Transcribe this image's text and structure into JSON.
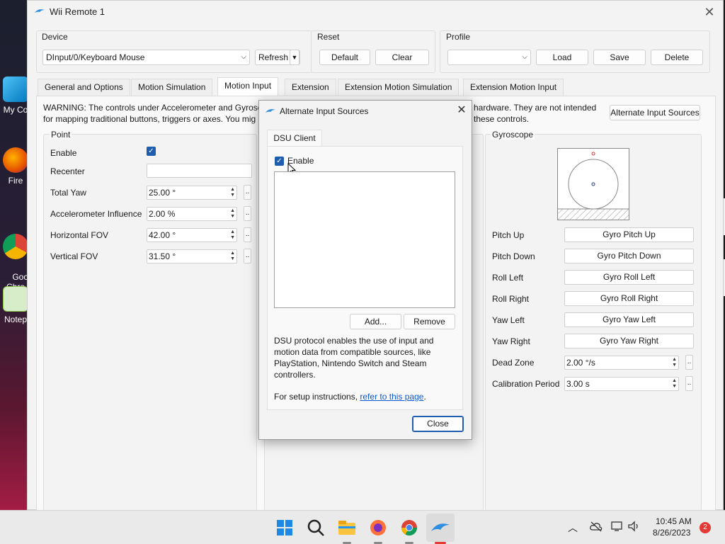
{
  "desktop": {
    "icons": [
      {
        "label": "My Co"
      },
      {
        "label": "Fire"
      },
      {
        "label": "Goo\nChro"
      },
      {
        "label": "Notep"
      }
    ]
  },
  "window": {
    "title": "Wii Remote 1",
    "device": {
      "group_label": "Device",
      "selected": "DInput/0/Keyboard Mouse",
      "refresh_label": "Refresh"
    },
    "reset": {
      "group_label": "Reset",
      "default_label": "Default",
      "clear_label": "Clear"
    },
    "profile": {
      "group_label": "Profile",
      "selected": "",
      "load_label": "Load",
      "save_label": "Save",
      "delete_label": "Delete"
    },
    "tabs": [
      {
        "label": "General and Options"
      },
      {
        "label": "Motion Simulation"
      },
      {
        "label": "Motion Input"
      },
      {
        "label": "Extension"
      },
      {
        "label": "Extension Motion Simulation"
      },
      {
        "label": "Extension Motion Input"
      }
    ],
    "warning_line1_left": "WARNING: The controls under Accelerometer and Gyrosc",
    "warning_line2_left": "for mapping traditional buttons, triggers or axes. You mig",
    "warning_line1_right": "hardware. They are not intended",
    "warning_line2_right": "these controls.",
    "alternate_sources_label": "Alternate Input Sources",
    "point": {
      "group_label": "Point",
      "enable_label": "Enable",
      "recenter_label": "Recenter",
      "rows": [
        {
          "label": "Total Yaw",
          "value": "25.00 °"
        },
        {
          "label": "Accelerometer Influence",
          "value": "2.00 %"
        },
        {
          "label": "Horizontal FOV",
          "value": "42.00 °"
        },
        {
          "label": "Vertical FOV",
          "value": "31.50 °"
        }
      ]
    },
    "gyroscope": {
      "group_label": "Gyroscope",
      "rows": [
        {
          "label": "Pitch Up",
          "button": "Gyro Pitch Up"
        },
        {
          "label": "Pitch Down",
          "button": "Gyro Pitch Down"
        },
        {
          "label": "Roll Left",
          "button": "Gyro Roll Left"
        },
        {
          "label": "Roll Right",
          "button": "Gyro Roll Right"
        },
        {
          "label": "Yaw Left",
          "button": "Gyro Yaw Left"
        },
        {
          "label": "Yaw Right",
          "button": "Gyro Yaw Right"
        }
      ],
      "dead_zone_label": "Dead Zone",
      "dead_zone_value": "2.00 °/s",
      "calibration_label": "Calibration Period",
      "calibration_value": "3.00 s"
    }
  },
  "dialog": {
    "title": "Alternate Input Sources",
    "tab_label": "DSU Client",
    "enable_label": "Enable",
    "add_label": "Add...",
    "remove_label": "Remove",
    "desc_line1": "DSU protocol enables the use of input and",
    "desc_line2": "motion data from compatible sources, like",
    "desc_line3": "PlayStation, Nintendo Switch and Steam",
    "desc_line4": "controllers.",
    "setup_text": "For setup instructions, ",
    "setup_link": "refer to this page",
    "setup_end": ".",
    "close_label": "Close"
  },
  "taskbar": {
    "time": "10:45 AM",
    "date": "8/26/2023",
    "notification_count": "2"
  },
  "colors": {
    "accent": "#1f5dae",
    "link": "#0b57d0"
  }
}
